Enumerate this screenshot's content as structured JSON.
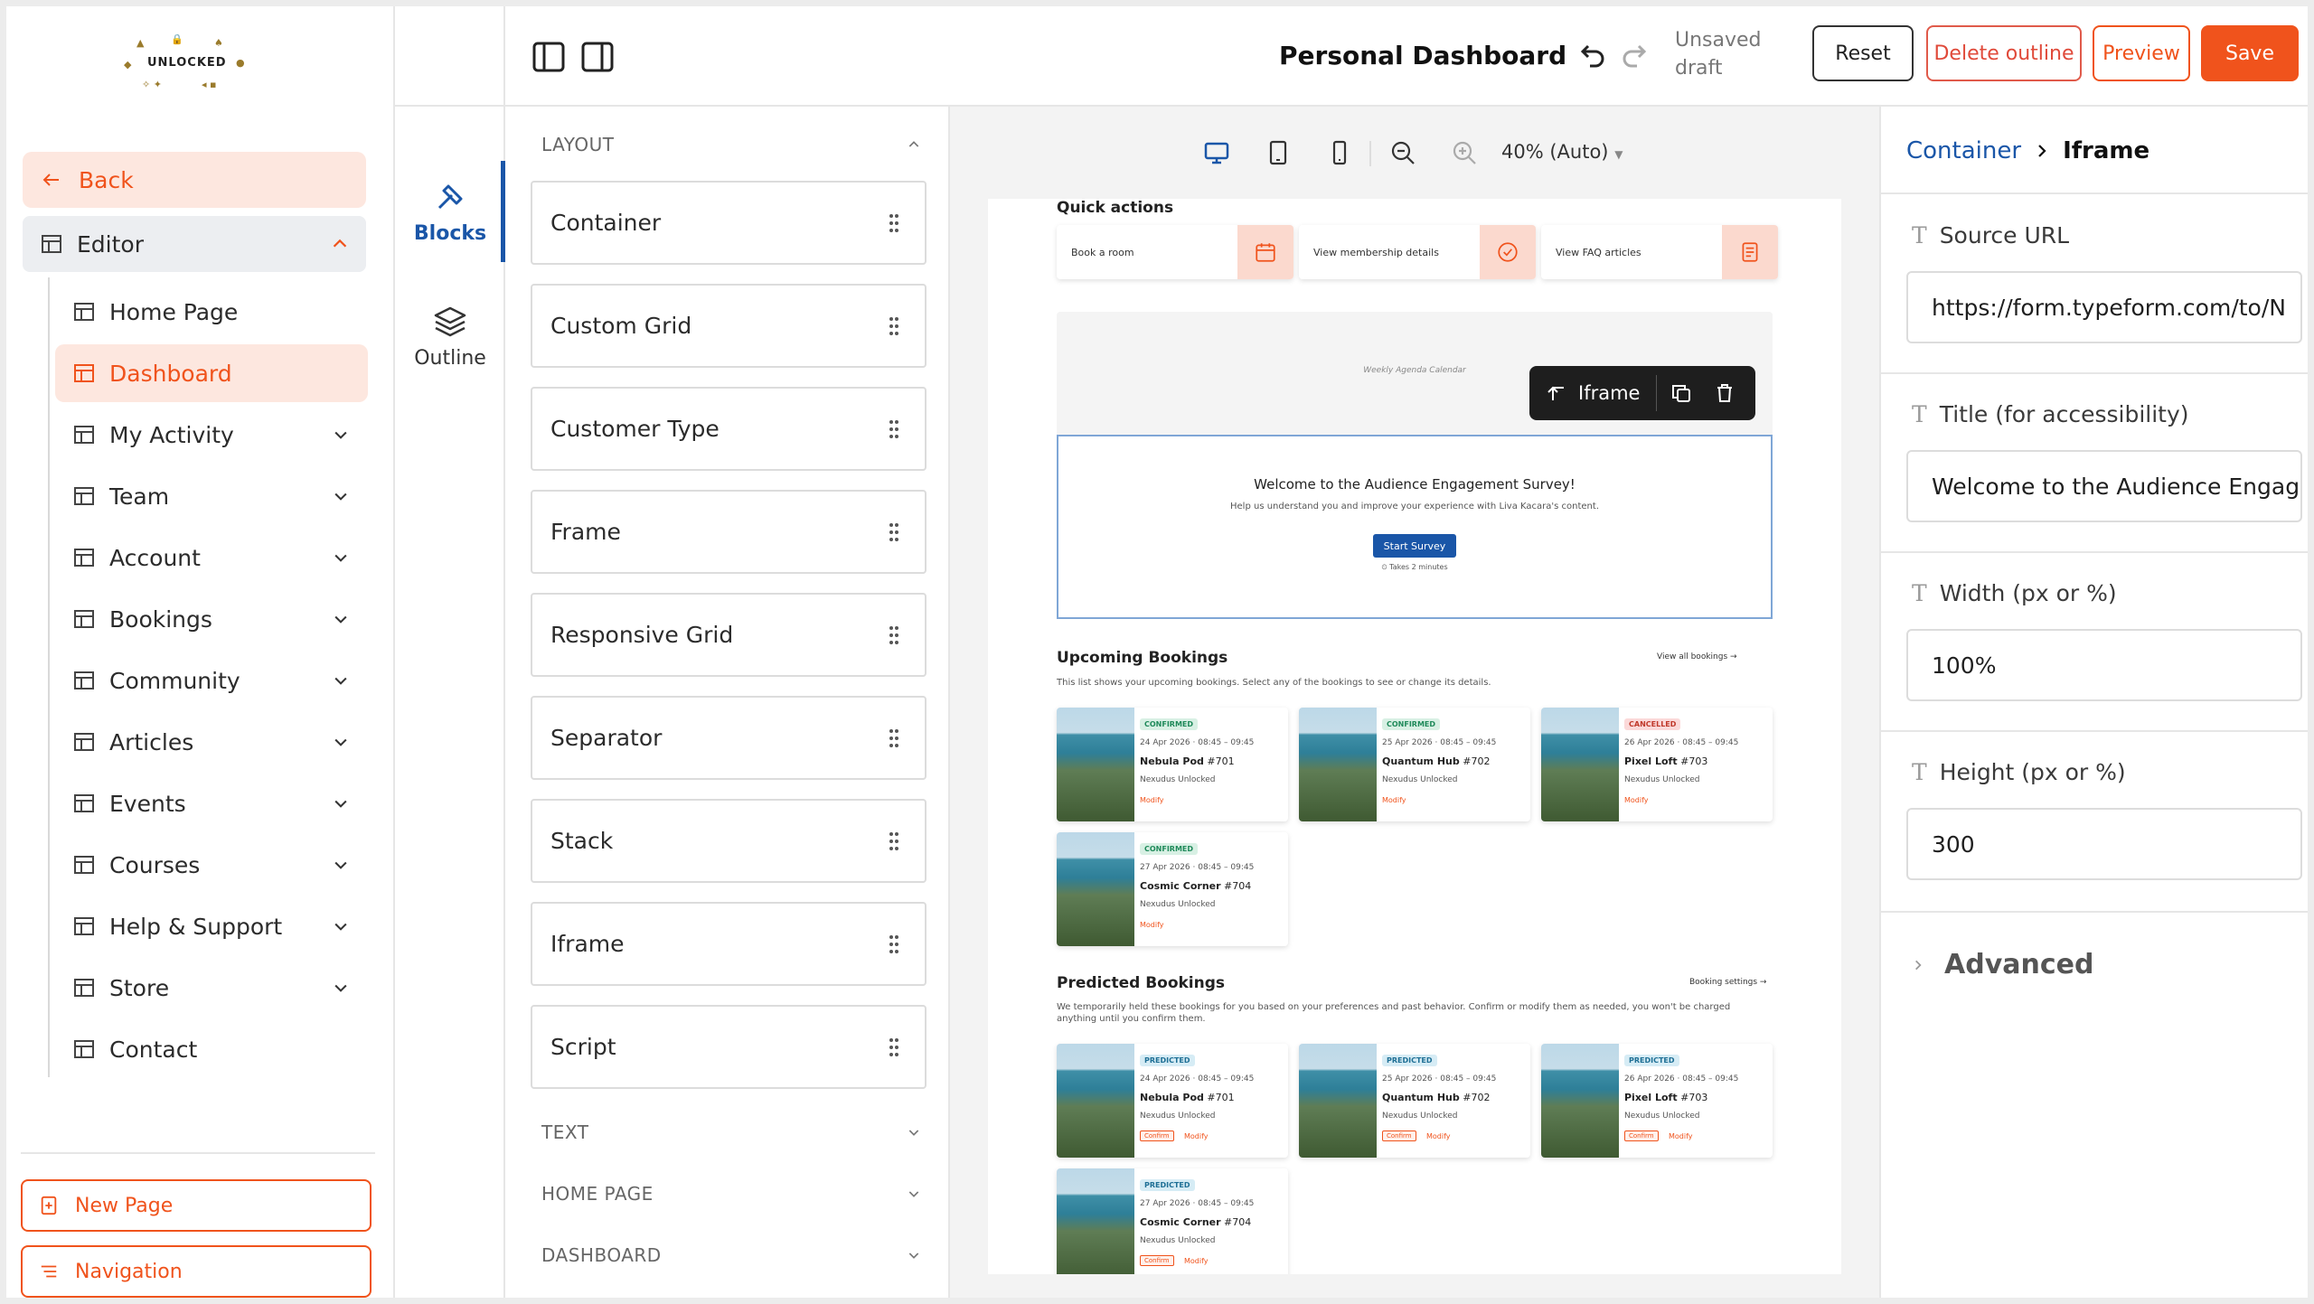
{
  "logo": {
    "text": "UNLOCKED"
  },
  "sidebar": {
    "back_label": "Back",
    "editor_label": "Editor",
    "items": [
      {
        "label": "Home Page",
        "expandable": false,
        "active": false
      },
      {
        "label": "Dashboard",
        "expandable": false,
        "active": true
      },
      {
        "label": "My Activity",
        "expandable": true,
        "active": false
      },
      {
        "label": "Team",
        "expandable": true,
        "active": false
      },
      {
        "label": "Account",
        "expandable": true,
        "active": false
      },
      {
        "label": "Bookings",
        "expandable": true,
        "active": false
      },
      {
        "label": "Community",
        "expandable": true,
        "active": false
      },
      {
        "label": "Articles",
        "expandable": true,
        "active": false
      },
      {
        "label": "Events",
        "expandable": true,
        "active": false
      },
      {
        "label": "Courses",
        "expandable": true,
        "active": false
      },
      {
        "label": "Help & Support",
        "expandable": true,
        "active": false
      },
      {
        "label": "Store",
        "expandable": true,
        "active": false
      },
      {
        "label": "Contact",
        "expandable": false,
        "active": false
      }
    ],
    "new_page_label": "New Page",
    "navigation_label": "Navigation"
  },
  "topbar": {
    "title": "Personal Dashboard",
    "draft_status": "Unsaved draft",
    "reset_label": "Reset",
    "delete_outline_label": "Delete outline",
    "preview_label": "Preview",
    "save_label": "Save"
  },
  "rail": {
    "blocks_label": "Blocks",
    "outline_label": "Outline"
  },
  "blocks_panel": {
    "layout_heading": "LAYOUT",
    "layout_blocks": [
      "Container",
      "Custom Grid",
      "Customer Type",
      "Frame",
      "Responsive Grid",
      "Separator",
      "Stack",
      "Iframe",
      "Script"
    ],
    "other_sections": [
      "TEXT",
      "HOME PAGE",
      "DASHBOARD"
    ]
  },
  "canvas": {
    "zoom_label": "40% (Auto)",
    "quick_actions_title": "Quick actions",
    "quick_actions": [
      "Book a room",
      "View membership details",
      "View FAQ articles"
    ],
    "calendar_placeholder": "Weekly Agenda Calendar",
    "iframe_toolbar_label": "Iframe",
    "survey": {
      "title": "Welcome to the Audience Engagement Survey!",
      "subtitle": "Help us understand you and improve your experience with Liva Kacara's content.",
      "button": "Start Survey",
      "note": "Takes 2 minutes"
    },
    "upcoming": {
      "title": "Upcoming Bookings",
      "link": "View all bookings →",
      "description": "This list shows your upcoming bookings. Select any of the bookings to see or change its details.",
      "cards": [
        {
          "status": "CONFIRMED",
          "date": "24 Apr 2026 · 08:45 – 09:45",
          "name": "Nebula Pod",
          "num": "#701",
          "org": "Nexudus Unlocked",
          "action": "Modify"
        },
        {
          "status": "CONFIRMED",
          "date": "25 Apr 2026 · 08:45 – 09:45",
          "name": "Quantum Hub",
          "num": "#702",
          "org": "Nexudus Unlocked",
          "action": "Modify"
        },
        {
          "status": "CANCELLED",
          "date": "26 Apr 2026 · 08:45 – 09:45",
          "name": "Pixel Loft",
          "num": "#703",
          "org": "Nexudus Unlocked",
          "action": "Modify"
        },
        {
          "status": "CONFIRMED",
          "date": "27 Apr 2026 · 08:45 – 09:45",
          "name": "Cosmic Corner",
          "num": "#704",
          "org": "Nexudus Unlocked",
          "action": "Modify"
        }
      ]
    },
    "predicted": {
      "title": "Predicted Bookings",
      "link": "Booking settings →",
      "description": "We temporarily held these bookings for you based on your preferences and past behavior. Confirm or modify them as needed, you won't be charged anything until you confirm them.",
      "cards": [
        {
          "status": "PREDICTED",
          "date": "24 Apr 2026 · 08:45 – 09:45",
          "name": "Nebula Pod",
          "num": "#701",
          "org": "Nexudus Unlocked",
          "confirm": "Confirm",
          "action": "Modify"
        },
        {
          "status": "PREDICTED",
          "date": "25 Apr 2026 · 08:45 – 09:45",
          "name": "Quantum Hub",
          "num": "#702",
          "org": "Nexudus Unlocked",
          "confirm": "Confirm",
          "action": "Modify"
        },
        {
          "status": "PREDICTED",
          "date": "26 Apr 2026 · 08:45 – 09:45",
          "name": "Pixel Loft",
          "num": "#703",
          "org": "Nexudus Unlocked",
          "confirm": "Confirm",
          "action": "Modify"
        },
        {
          "status": "PREDICTED",
          "date": "27 Apr 2026 · 08:45 – 09:45",
          "name": "Cosmic Corner",
          "num": "#704",
          "org": "Nexudus Unlocked",
          "confirm": "Confirm",
          "action": "Modify"
        }
      ]
    }
  },
  "properties": {
    "breadcrumb_parent": "Container",
    "breadcrumb_current": "Iframe",
    "source_url_label": "Source URL",
    "source_url_value": "https://form.typeform.com/to/N",
    "title_label": "Title (for accessibility)",
    "title_value": "Welcome to the Audience Engag",
    "width_label": "Width (px or %)",
    "width_value": "100%",
    "height_label": "Height (px or %)",
    "height_value": "300",
    "advanced_label": "Advanced"
  },
  "colors": {
    "accent": "#f0531c",
    "accent_soft": "#fde7df",
    "link_blue": "#1a56a8",
    "confirmed_badge": "#d8f0e4",
    "cancelled_badge": "#fbd9d9",
    "predicted_badge": "#d6ecf5"
  }
}
